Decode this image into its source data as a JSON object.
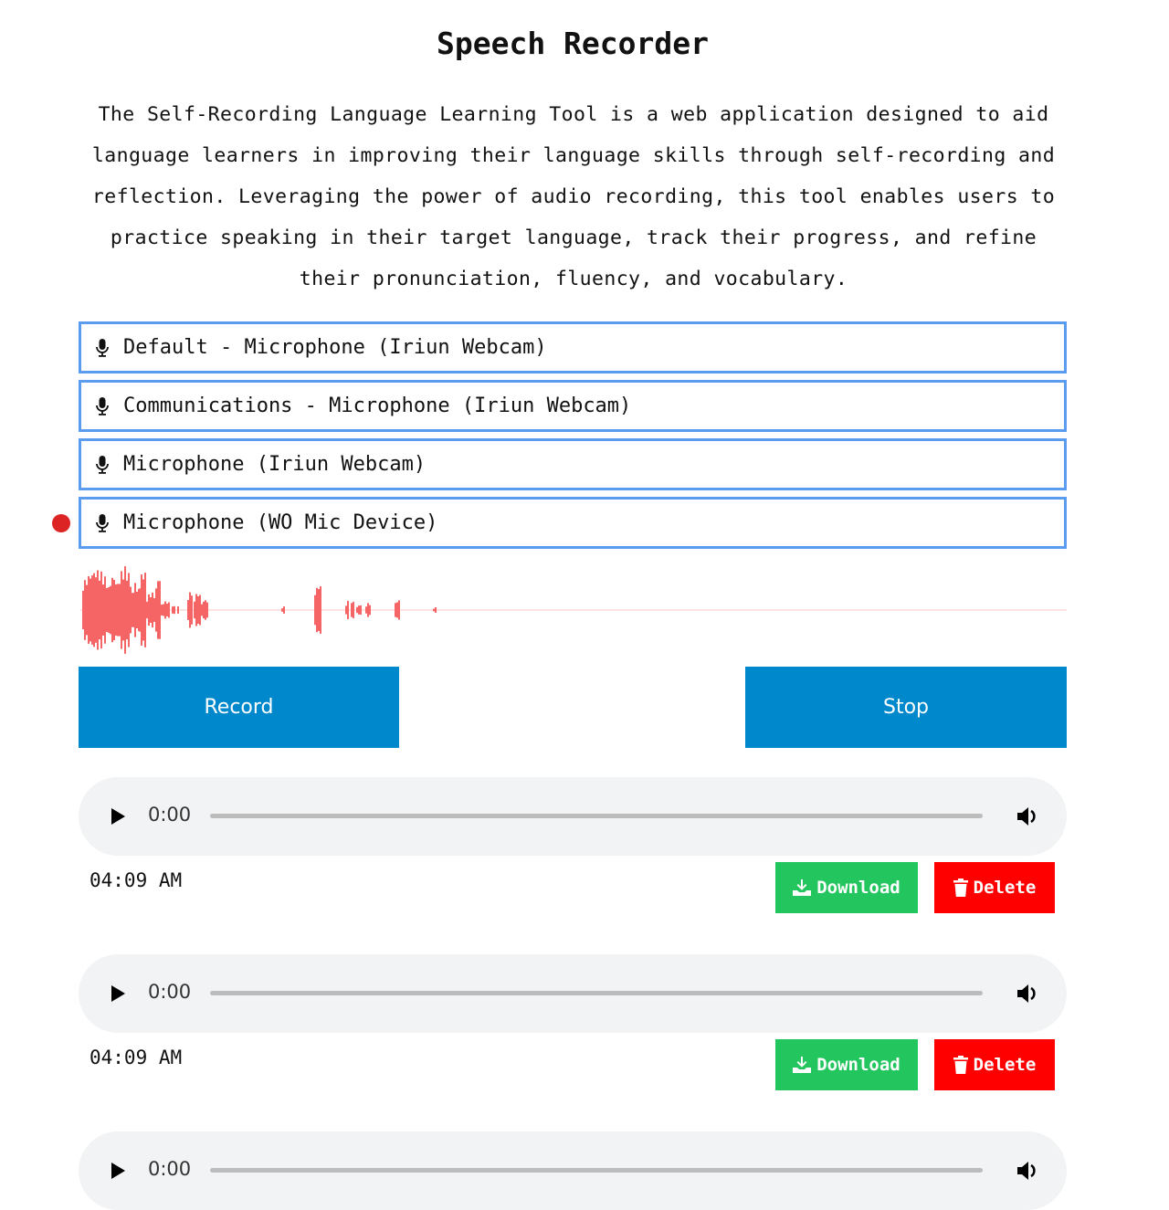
{
  "page": {
    "title": "Speech Recorder",
    "description": "The Self-Recording Language Learning Tool is a web application designed to aid language learners in improving their language skills through self-recording and reflection. Leveraging the power of audio recording, this tool enables users to practice speaking in their target language, track their progress, and refine their pronunciation, fluency, and vocabulary."
  },
  "microphones": [
    {
      "label": "Default - Microphone (Iriun Webcam)",
      "icon": "microphone-icon",
      "selected": false
    },
    {
      "label": "Communications - Microphone (Iriun Webcam)",
      "icon": "microphone-icon",
      "selected": false
    },
    {
      "label": "Microphone (Iriun Webcam)",
      "icon": "microphone-icon",
      "selected": false
    },
    {
      "label": "Microphone (WO Mic Device)",
      "icon": "microphone-icon",
      "selected": true
    }
  ],
  "controls": {
    "record_label": "Record",
    "stop_label": "Stop"
  },
  "recordings": [
    {
      "current_time": "0:00",
      "timestamp": "04:09 AM",
      "download_label": "Download",
      "delete_label": "Delete"
    },
    {
      "current_time": "0:00",
      "timestamp": "04:09 AM",
      "download_label": "Download",
      "delete_label": "Delete"
    },
    {
      "current_time": "0:00"
    }
  ],
  "colors": {
    "accent_blue": "#0088cc",
    "mic_border": "#5b9cf0",
    "recording_dot": "#dd2424",
    "waveform": "#f56565",
    "download_green": "#22c55e",
    "delete_red": "#ff0000",
    "player_bg": "#f1f3f4"
  }
}
